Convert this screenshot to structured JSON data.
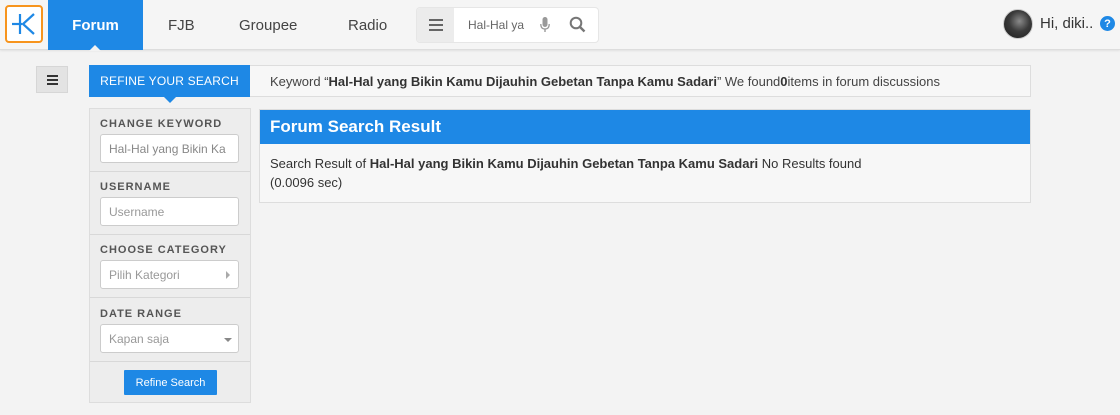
{
  "nav": {
    "forum": "Forum",
    "fjb": "FJB",
    "groupee": "Groupee",
    "radio": "Radio"
  },
  "search": {
    "value": "Hal-Hal ya"
  },
  "user": {
    "greeting": "Hi, diki.."
  },
  "help": {
    "label": "?"
  },
  "refine_tab": "REFINE YOUR SEARCH",
  "keyword_bar": {
    "prefix": "Keyword “",
    "keyword": "Hal-Hal yang Bikin Kamu Dijauhin Gebetan Tanpa Kamu Sadari",
    "middle": "” We found ",
    "count": "0",
    "suffix": " items in forum discussions"
  },
  "filter": {
    "keyword_label": "CHANGE KEYWORD",
    "keyword_value": "Hal-Hal yang Bikin Ka",
    "username_label": "USERNAME",
    "username_placeholder": "Username",
    "category_label": "CHOOSE CATEGORY",
    "category_value": "Pilih Kategori",
    "date_label": "DATE RANGE",
    "date_value": "Kapan saja",
    "button": "Refine Search"
  },
  "result": {
    "title": "Forum Search Result",
    "prefix": "Search Result of ",
    "keyword": "Hal-Hal yang Bikin Kamu Dijauhin Gebetan Tanpa Kamu Sadari",
    "status": " No Results found",
    "time": "(0.0096 sec)"
  },
  "colors": {
    "accent": "#1e88e5",
    "logo": "#f7941d"
  }
}
